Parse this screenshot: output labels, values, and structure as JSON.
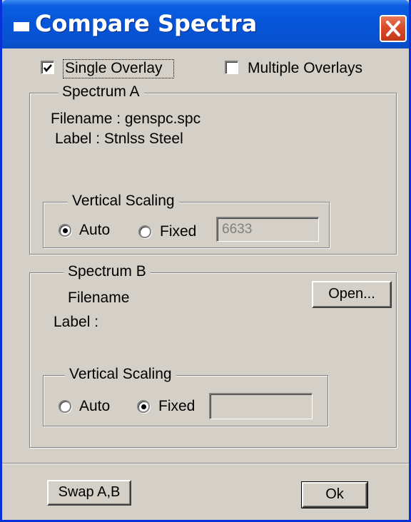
{
  "window": {
    "title": "Compare Spectra"
  },
  "overlay_options": {
    "single": {
      "label": "Single Overlay",
      "checked": true
    },
    "multiple": {
      "label": "Multiple Overlays",
      "checked": false
    }
  },
  "spectrum_a": {
    "group_title": "Spectrum A",
    "filename_line": "Filename :  genspc.spc",
    "label_line": "Label : Stnlss Steel",
    "vertical_scaling": {
      "title": "Vertical Scaling",
      "auto_label": "Auto",
      "fixed_label": "Fixed",
      "selected": "Auto",
      "fixed_value": "6633"
    }
  },
  "spectrum_b": {
    "group_title": "Spectrum B",
    "filename_line": "Filename",
    "label_line": "Label :",
    "open_button": "Open...",
    "vertical_scaling": {
      "title": "Vertical Scaling",
      "auto_label": "Auto",
      "fixed_label": "Fixed",
      "selected": "Fixed",
      "fixed_value": ""
    }
  },
  "buttons": {
    "swap": "Swap A,B",
    "ok": "Ok"
  },
  "colors": {
    "titlebar": "#0754d8",
    "dialog_bg": "#d4d0c8",
    "close_button": "#d94c2a"
  }
}
